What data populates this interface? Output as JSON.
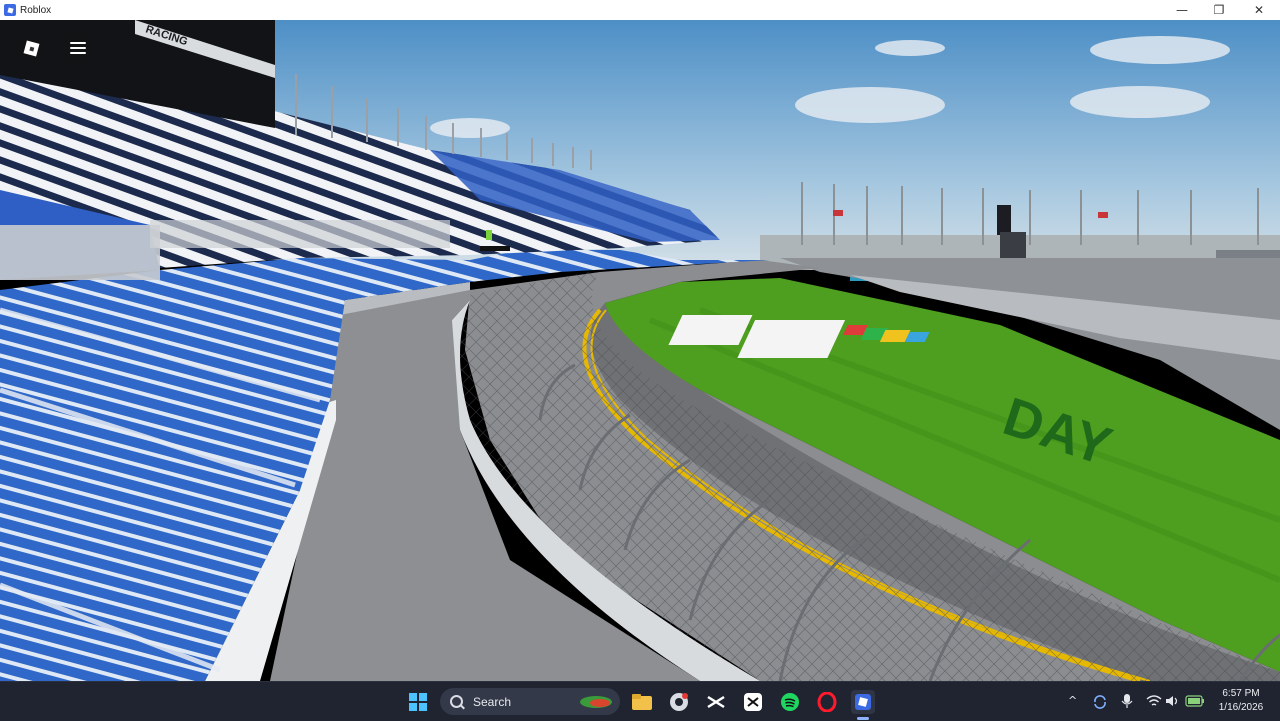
{
  "window": {
    "title": "Roblox",
    "controls": {
      "minimize": "—",
      "maximize": "❐",
      "close": "✕"
    }
  },
  "game": {
    "grandstand_sign": "RACING",
    "menu_icon": "hamburger-menu-icon",
    "logo_icon": "roblox-logo-icon",
    "infield_banner": "DAY",
    "colors": {
      "seats": "#1f5bc4",
      "grass": "#4e9e1f",
      "sky": "#7fb0d8",
      "track": "#8b8d90",
      "stripe": "#e6b800"
    }
  },
  "taskbar": {
    "search_label": "Search",
    "pinned": [
      {
        "name": "windows-start-icon"
      },
      {
        "name": "widgets-icon"
      },
      {
        "name": "file-explorer-icon"
      },
      {
        "name": "chrome-icon"
      },
      {
        "name": "capcut-icon"
      },
      {
        "name": "capcut-alt-icon"
      },
      {
        "name": "spotify-icon"
      },
      {
        "name": "opera-icon"
      },
      {
        "name": "roblox-icon"
      }
    ],
    "tray": {
      "chevron": "^",
      "clock_time": "6:57 PM",
      "clock_date": "1/16/2026"
    }
  }
}
